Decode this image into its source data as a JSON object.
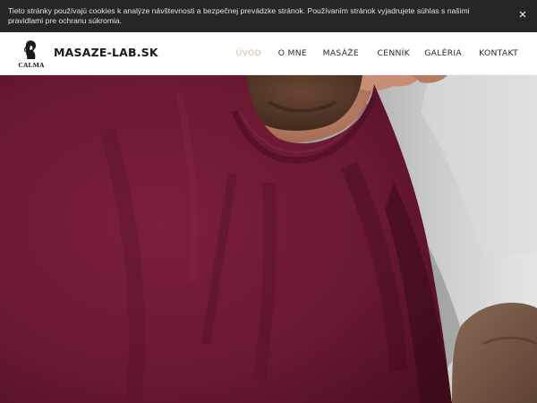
{
  "cookie_bar": {
    "text": "Tieto stránky používajú cookies k analýze návštevnosti a bezpečnej prevádzke stránok. Používaním stránok vyjadrujete súhlas s našimi pravidlami pre ochranu súkromia.",
    "close_icon": "close-icon"
  },
  "header": {
    "logo_text": "CALMA",
    "brand": "MASAZE-LAB.SK"
  },
  "nav": {
    "items": [
      {
        "label": "ÚVOD",
        "active": true
      },
      {
        "label": "O MNE",
        "active": false
      },
      {
        "label": "MASÁŽE",
        "active": false
      },
      {
        "label": "CENNÍK",
        "active": false
      },
      {
        "label": "GALÉRIA",
        "active": false
      },
      {
        "label": "KONTAKT",
        "active": false
      }
    ]
  },
  "colors": {
    "cookie_bg": "#262626",
    "active_nav": "#cfc09a",
    "shirt": "#6e1a34"
  }
}
